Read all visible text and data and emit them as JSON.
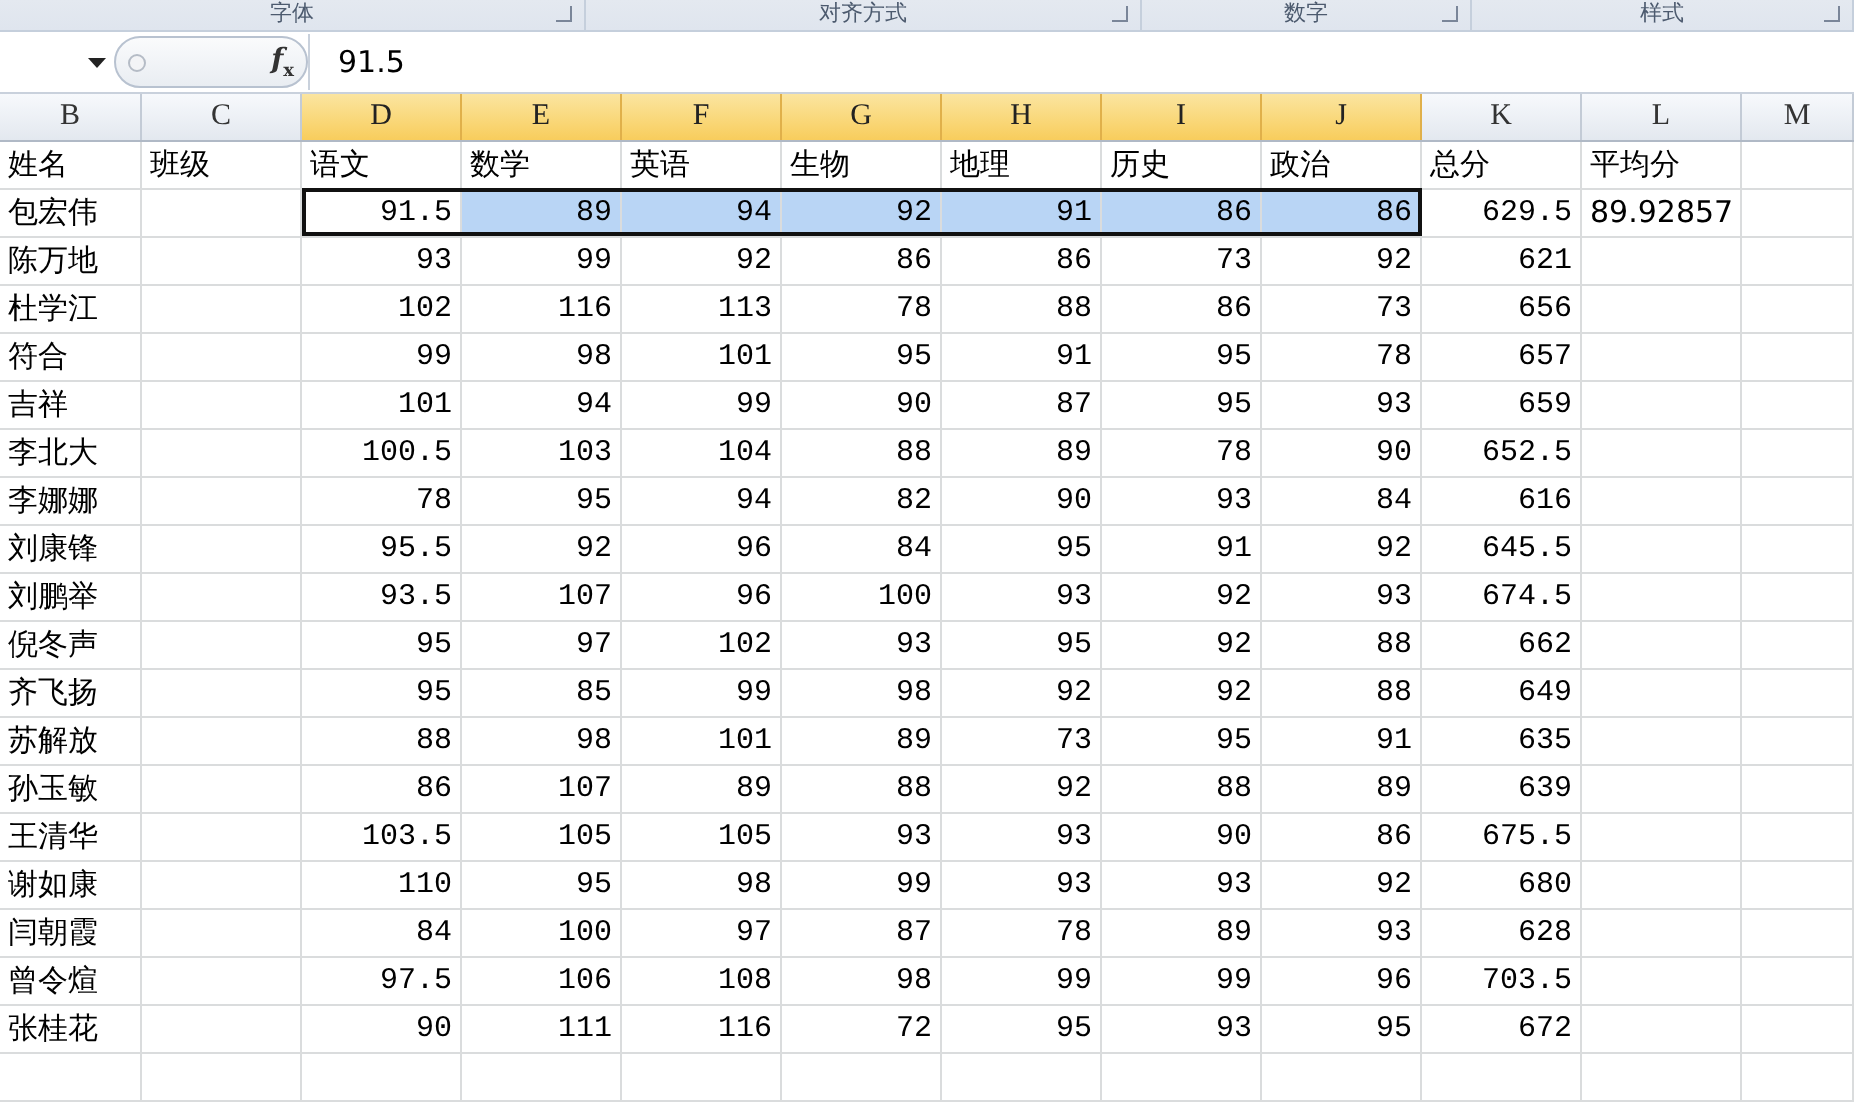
{
  "ribbon_groups": [
    {
      "label": "字体"
    },
    {
      "label": "对齐方式"
    },
    {
      "label": "数字"
    },
    {
      "label": "样式"
    }
  ],
  "formula_bar": {
    "function_label": "*f*$_{x}$",
    "value": "91.5"
  },
  "columns": [
    {
      "letter": "B",
      "selected": false
    },
    {
      "letter": "C",
      "selected": false
    },
    {
      "letter": "D",
      "selected": true
    },
    {
      "letter": "E",
      "selected": true
    },
    {
      "letter": "F",
      "selected": true
    },
    {
      "letter": "G",
      "selected": true
    },
    {
      "letter": "H",
      "selected": true
    },
    {
      "letter": "I",
      "selected": true
    },
    {
      "letter": "J",
      "selected": true
    },
    {
      "letter": "K",
      "selected": false
    },
    {
      "letter": "L",
      "selected": false
    },
    {
      "letter": "M",
      "selected": false
    }
  ],
  "header": [
    "姓名",
    "班级",
    "语文",
    "数学",
    "英语",
    "生物",
    "地理",
    "历史",
    "政治",
    "总分",
    "平均分"
  ],
  "rows": [
    {
      "name": "包宏伟",
      "scores": [
        "91.5",
        "89",
        "94",
        "92",
        "91",
        "86",
        "86"
      ],
      "total": "629.5",
      "average": "89.92857",
      "selected": true
    },
    {
      "name": "陈万地",
      "scores": [
        "93",
        "99",
        "92",
        "86",
        "86",
        "73",
        "92"
      ],
      "total": "621",
      "selected": false
    },
    {
      "name": "杜学江",
      "scores": [
        "102",
        "116",
        "113",
        "78",
        "88",
        "86",
        "73"
      ],
      "total": "656",
      "selected": false
    },
    {
      "name": "符合",
      "scores": [
        "99",
        "98",
        "101",
        "95",
        "91",
        "95",
        "78"
      ],
      "total": "657",
      "selected": false
    },
    {
      "name": "吉祥",
      "scores": [
        "101",
        "94",
        "99",
        "90",
        "87",
        "95",
        "93"
      ],
      "total": "659",
      "selected": false
    },
    {
      "name": "李北大",
      "scores": [
        "100.5",
        "103",
        "104",
        "88",
        "89",
        "78",
        "90"
      ],
      "total": "652.5",
      "selected": false
    },
    {
      "name": "李娜娜",
      "scores": [
        "78",
        "95",
        "94",
        "82",
        "90",
        "93",
        "84"
      ],
      "total": "616",
      "selected": false
    },
    {
      "name": "刘康锋",
      "scores": [
        "95.5",
        "92",
        "96",
        "84",
        "95",
        "91",
        "92"
      ],
      "total": "645.5",
      "selected": false
    },
    {
      "name": "刘鹏举",
      "scores": [
        "93.5",
        "107",
        "96",
        "100",
        "93",
        "92",
        "93"
      ],
      "total": "674.5",
      "selected": false
    },
    {
      "name": "倪冬声",
      "scores": [
        "95",
        "97",
        "102",
        "93",
        "95",
        "92",
        "88"
      ],
      "total": "662",
      "selected": false
    },
    {
      "name": "齐飞扬",
      "scores": [
        "95",
        "85",
        "99",
        "98",
        "92",
        "92",
        "88"
      ],
      "total": "649",
      "selected": false
    },
    {
      "name": "苏解放",
      "scores": [
        "88",
        "98",
        "101",
        "89",
        "73",
        "95",
        "91"
      ],
      "total": "635",
      "selected": false
    },
    {
      "name": "孙玉敏",
      "scores": [
        "86",
        "107",
        "89",
        "88",
        "92",
        "88",
        "89"
      ],
      "total": "639",
      "selected": false
    },
    {
      "name": "王清华",
      "scores": [
        "103.5",
        "105",
        "105",
        "93",
        "93",
        "90",
        "86"
      ],
      "total": "675.5",
      "selected": false
    },
    {
      "name": "谢如康",
      "scores": [
        "110",
        "95",
        "98",
        "99",
        "93",
        "93",
        "92"
      ],
      "total": "680",
      "selected": false
    },
    {
      "name": "闫朝霞",
      "scores": [
        "84",
        "100",
        "97",
        "87",
        "78",
        "89",
        "93"
      ],
      "total": "628",
      "selected": false
    },
    {
      "name": "曾令煊",
      "scores": [
        "97.5",
        "106",
        "108",
        "98",
        "99",
        "99",
        "96"
      ],
      "total": "703.5",
      "selected": false
    },
    {
      "name": "张桂花",
      "scores": [
        "90",
        "111",
        "116",
        "72",
        "95",
        "93",
        "95"
      ],
      "total": "672",
      "selected": false
    }
  ]
}
